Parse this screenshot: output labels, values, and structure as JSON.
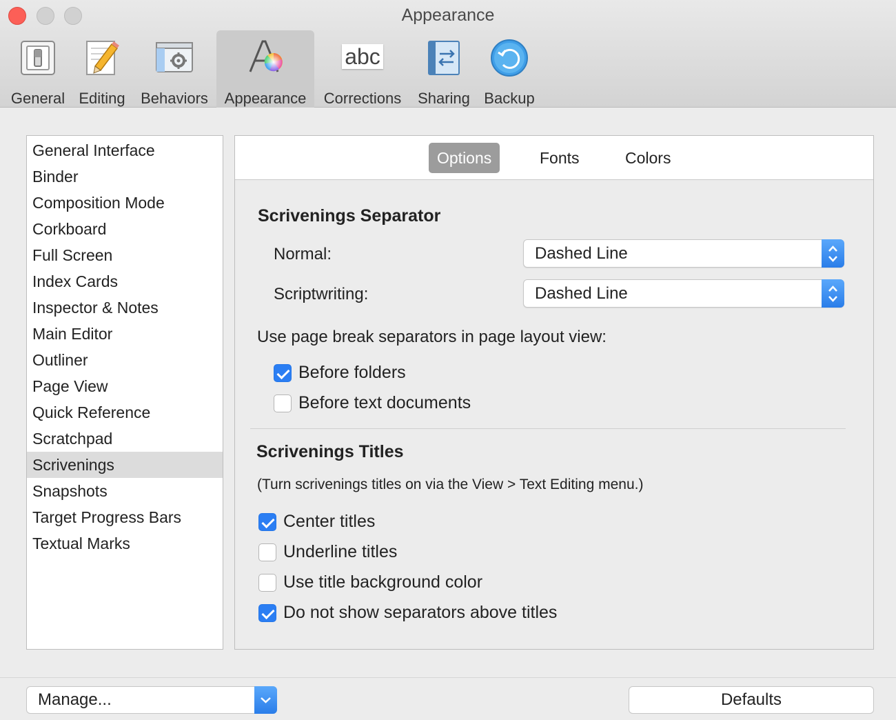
{
  "window": {
    "title": "Appearance"
  },
  "toolbar": {
    "items": [
      {
        "label": "General",
        "icon": "general-switch-icon"
      },
      {
        "label": "Editing",
        "icon": "pencil-icon"
      },
      {
        "label": "Behaviors",
        "icon": "gear-window-icon"
      },
      {
        "label": "Appearance",
        "icon": "font-color-wheel-icon",
        "selected": true
      },
      {
        "label": "Corrections",
        "icon": "abc-icon",
        "icon_text": "abc"
      },
      {
        "label": "Sharing",
        "icon": "sync-arrows-icon"
      },
      {
        "label": "Backup",
        "icon": "backup-restore-icon"
      }
    ]
  },
  "sidebar": {
    "items": [
      {
        "label": "General Interface"
      },
      {
        "label": "Binder"
      },
      {
        "label": "Composition Mode"
      },
      {
        "label": "Corkboard"
      },
      {
        "label": "Full Screen"
      },
      {
        "label": "Index Cards"
      },
      {
        "label": "Inspector & Notes"
      },
      {
        "label": "Main Editor"
      },
      {
        "label": "Outliner"
      },
      {
        "label": "Page View"
      },
      {
        "label": "Quick Reference"
      },
      {
        "label": "Scratchpad"
      },
      {
        "label": "Scrivenings",
        "selected": true
      },
      {
        "label": "Snapshots"
      },
      {
        "label": "Target Progress Bars"
      },
      {
        "label": "Textual Marks"
      }
    ]
  },
  "tabs": [
    {
      "label": "Options",
      "active": true
    },
    {
      "label": "Fonts"
    },
    {
      "label": "Colors"
    }
  ],
  "separator": {
    "title": "Scrivenings Separator",
    "normal_label": "Normal:",
    "normal_value": "Dashed Line",
    "scriptwriting_label": "Scriptwriting:",
    "scriptwriting_value": "Dashed Line",
    "page_break_label": "Use page break separators in page layout view:",
    "before_folders": {
      "label": "Before folders",
      "checked": true
    },
    "before_text_documents": {
      "label": "Before text documents",
      "checked": false
    }
  },
  "titles": {
    "title": "Scrivenings Titles",
    "note": "(Turn scrivenings titles on via the View > Text Editing menu.)",
    "center_titles": {
      "label": "Center titles",
      "checked": true
    },
    "underline_titles": {
      "label": "Underline titles",
      "checked": false
    },
    "use_title_background": {
      "label": "Use title background color",
      "checked": false
    },
    "no_separators_above": {
      "label": "Do not show separators above titles",
      "checked": true
    }
  },
  "bottom": {
    "manage_label": "Manage...",
    "defaults_label": "Defaults"
  },
  "colors": {
    "accent": "#2b7ef3",
    "close": "#fc5f57"
  }
}
